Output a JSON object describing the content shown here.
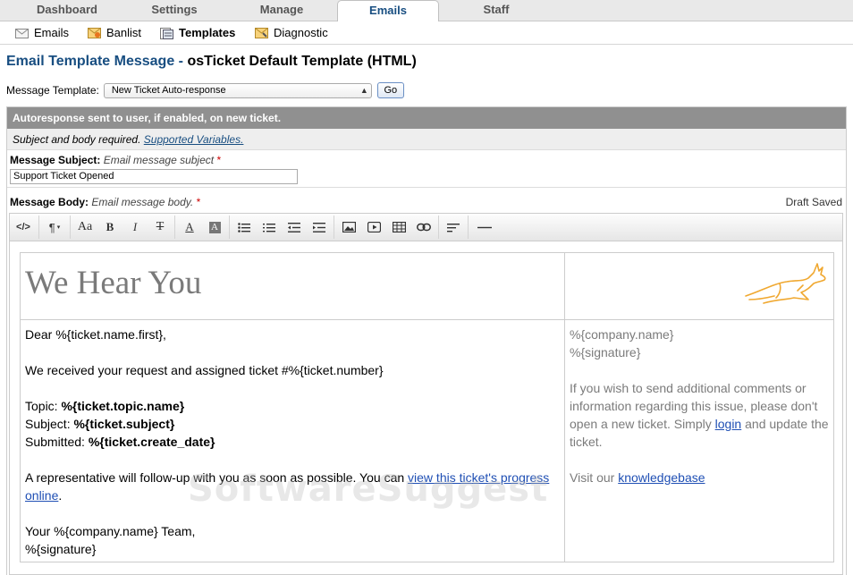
{
  "nav": {
    "tabs": [
      {
        "label": "Dashboard"
      },
      {
        "label": "Settings"
      },
      {
        "label": "Manage"
      },
      {
        "label": "Emails",
        "active": true
      },
      {
        "label": "Staff"
      }
    ]
  },
  "subnav": {
    "items": [
      {
        "label": "Emails",
        "icon": "envelope-icon"
      },
      {
        "label": "Banlist",
        "icon": "banlist-icon"
      },
      {
        "label": "Templates",
        "icon": "templates-icon",
        "active": true
      },
      {
        "label": "Diagnostic",
        "icon": "diagnostic-icon"
      }
    ]
  },
  "page": {
    "title": "Email Template Message - ",
    "template_name": "osTicket Default Template (HTML)"
  },
  "template_select": {
    "label": "Message Template:",
    "value": "New Ticket Auto-response",
    "go_label": "Go"
  },
  "form": {
    "header": "Autoresponse sent to user, if enabled, on new ticket.",
    "sub_text": "Subject and body required.",
    "sub_link": "Supported Variables.",
    "subject_label": "Message Subject:",
    "subject_hint": "Email message subject",
    "required_mark": "*",
    "subject_value": "Support Ticket Opened",
    "body_label": "Message Body:",
    "body_hint": "Email message body.",
    "draft_status": "Draft Saved"
  },
  "toolbar": {
    "buttons": [
      "html-icon",
      "paragraph-icon",
      "font-size-icon",
      "bold-icon",
      "italic-icon",
      "strikethrough-icon",
      "font-color-icon",
      "background-color-icon",
      "unordered-list-icon",
      "ordered-list-icon",
      "outdent-icon",
      "indent-icon",
      "image-icon",
      "video-icon",
      "table-icon",
      "link-icon",
      "align-icon",
      "horizontal-rule-icon"
    ]
  },
  "email": {
    "heading": "We Hear You",
    "greeting": "Dear %{ticket.name.first},",
    "received": "We received your request and assigned ticket #%{ticket.number}",
    "topic_label": "Topic: ",
    "topic_value": "%{ticket.topic.name}",
    "subject_label": "Subject: ",
    "subject_value": "%{ticket.subject}",
    "submitted_label": "Submitted: ",
    "submitted_value": "%{ticket.create_date}",
    "followup_text": "A representative will follow-up with you as soon as possible. You can ",
    "followup_link": "view this ticket's progress online",
    "followup_end": ".",
    "signoff": "Your %{company.name} Team,",
    "signature": "%{signature}",
    "side_company": "%{company.name}",
    "side_signature": "%{signature}",
    "side_note_1": "If you wish to send additional comments or information regarding this issue, please don't open a new ticket. Simply ",
    "side_login": "login",
    "side_note_2": " and update the ticket.",
    "side_visit": "Visit our ",
    "side_kb": "knowledgebase"
  },
  "watermark": "SoftwareSuggest",
  "colors": {
    "accent": "#184e81",
    "header_bar": "#909090",
    "link": "#1f4fb4",
    "logo": "#f0a830"
  }
}
